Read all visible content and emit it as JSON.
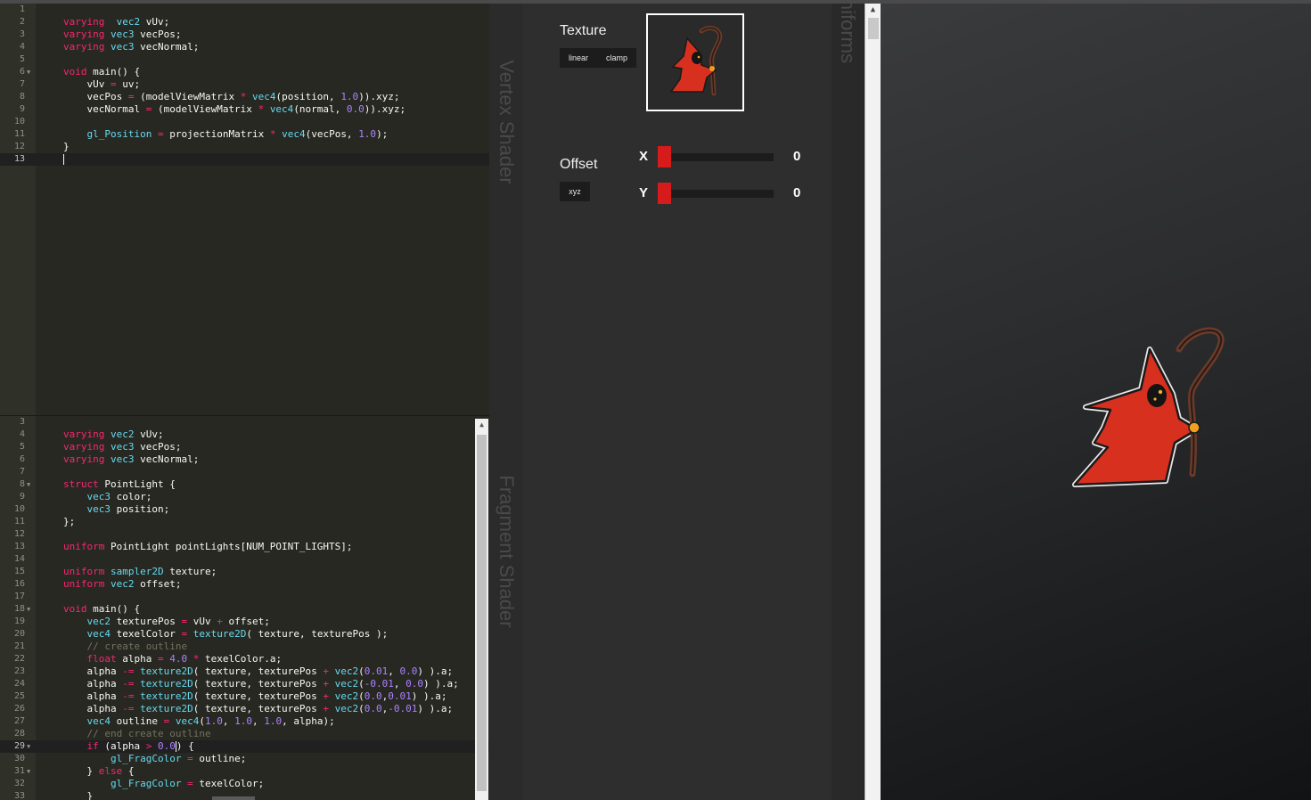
{
  "vertex_shader": {
    "tab_label": "Vertex Shader",
    "lines": [
      {
        "n": "1",
        "fold": false,
        "code": []
      },
      {
        "n": "2",
        "fold": false,
        "code": [
          [
            "kw",
            "varying"
          ],
          [
            "",
            "  "
          ],
          [
            "ty",
            "vec2"
          ],
          [
            "",
            " vUv;"
          ]
        ]
      },
      {
        "n": "3",
        "fold": false,
        "code": [
          [
            "kw",
            "varying"
          ],
          [
            "",
            " "
          ],
          [
            "ty",
            "vec3"
          ],
          [
            "",
            " vecPos;"
          ]
        ]
      },
      {
        "n": "4",
        "fold": false,
        "code": [
          [
            "kw",
            "varying"
          ],
          [
            "",
            " "
          ],
          [
            "ty",
            "vec3"
          ],
          [
            "",
            " vecNormal;"
          ]
        ]
      },
      {
        "n": "5",
        "fold": false,
        "code": []
      },
      {
        "n": "6",
        "fold": true,
        "code": [
          [
            "kw",
            "void"
          ],
          [
            "",
            " main() {"
          ]
        ]
      },
      {
        "n": "7",
        "fold": false,
        "code": [
          [
            "",
            "    vUv "
          ],
          [
            "kw",
            "="
          ],
          [
            "",
            " uv;"
          ]
        ]
      },
      {
        "n": "8",
        "fold": false,
        "code": [
          [
            "",
            "    vecPos "
          ],
          [
            "kw",
            "="
          ],
          [
            "",
            " (modelViewMatrix "
          ],
          [
            "kw",
            "*"
          ],
          [
            "",
            " "
          ],
          [
            "fn",
            "vec4"
          ],
          [
            "",
            "(position, "
          ],
          [
            "num",
            "1.0"
          ],
          [
            "",
            ")).xyz;"
          ]
        ]
      },
      {
        "n": "9",
        "fold": false,
        "code": [
          [
            "",
            "    vecNormal "
          ],
          [
            "kw",
            "="
          ],
          [
            "",
            " (modelViewMatrix "
          ],
          [
            "kw",
            "*"
          ],
          [
            "",
            " "
          ],
          [
            "fn",
            "vec4"
          ],
          [
            "",
            "(normal, "
          ],
          [
            "num",
            "0.0"
          ],
          [
            "",
            ")).xyz;"
          ]
        ]
      },
      {
        "n": "10",
        "fold": false,
        "code": []
      },
      {
        "n": "11",
        "fold": false,
        "code": [
          [
            "",
            "    "
          ],
          [
            "ty",
            "gl_Position"
          ],
          [
            "",
            " "
          ],
          [
            "kw",
            "="
          ],
          [
            "",
            " projectionMatrix "
          ],
          [
            "kw",
            "*"
          ],
          [
            "",
            " "
          ],
          [
            "fn",
            "vec4"
          ],
          [
            "",
            "(vecPos, "
          ],
          [
            "num",
            "1.0"
          ],
          [
            "",
            ");"
          ]
        ]
      },
      {
        "n": "12",
        "fold": false,
        "code": [
          [
            "",
            "}"
          ]
        ]
      },
      {
        "n": "13",
        "fold": false,
        "active": true,
        "cursor": true,
        "code": []
      }
    ]
  },
  "fragment_shader": {
    "tab_label": "Fragment Shader",
    "lines": [
      {
        "n": "3",
        "fold": false,
        "code": []
      },
      {
        "n": "4",
        "fold": false,
        "code": [
          [
            "kw",
            "varying"
          ],
          [
            "",
            " "
          ],
          [
            "ty",
            "vec2"
          ],
          [
            "",
            " vUv;"
          ]
        ]
      },
      {
        "n": "5",
        "fold": false,
        "code": [
          [
            "kw",
            "varying"
          ],
          [
            "",
            " "
          ],
          [
            "ty",
            "vec3"
          ],
          [
            "",
            " vecPos;"
          ]
        ]
      },
      {
        "n": "6",
        "fold": false,
        "code": [
          [
            "kw",
            "varying"
          ],
          [
            "",
            " "
          ],
          [
            "ty",
            "vec3"
          ],
          [
            "",
            " vecNormal;"
          ]
        ]
      },
      {
        "n": "7",
        "fold": false,
        "code": []
      },
      {
        "n": "8",
        "fold": true,
        "code": [
          [
            "kw",
            "struct"
          ],
          [
            "",
            " PointLight {"
          ]
        ]
      },
      {
        "n": "9",
        "fold": false,
        "code": [
          [
            "",
            "    "
          ],
          [
            "ty",
            "vec3"
          ],
          [
            "",
            " color;"
          ]
        ]
      },
      {
        "n": "10",
        "fold": false,
        "code": [
          [
            "",
            "    "
          ],
          [
            "ty",
            "vec3"
          ],
          [
            "",
            " position;"
          ]
        ]
      },
      {
        "n": "11",
        "fold": false,
        "code": [
          [
            "",
            "};"
          ]
        ]
      },
      {
        "n": "12",
        "fold": false,
        "code": []
      },
      {
        "n": "13",
        "fold": false,
        "code": [
          [
            "kw",
            "uniform"
          ],
          [
            "",
            " PointLight pointLights[NUM_POINT_LIGHTS];"
          ]
        ]
      },
      {
        "n": "14",
        "fold": false,
        "code": []
      },
      {
        "n": "15",
        "fold": false,
        "code": [
          [
            "kw",
            "uniform"
          ],
          [
            "",
            " "
          ],
          [
            "ty",
            "sampler2D"
          ],
          [
            "",
            " texture;"
          ]
        ]
      },
      {
        "n": "16",
        "fold": false,
        "code": [
          [
            "kw",
            "uniform"
          ],
          [
            "",
            " "
          ],
          [
            "ty",
            "vec2"
          ],
          [
            "",
            " offset;"
          ]
        ]
      },
      {
        "n": "17",
        "fold": false,
        "code": []
      },
      {
        "n": "18",
        "fold": true,
        "code": [
          [
            "kw",
            "void"
          ],
          [
            "",
            " main() {"
          ]
        ]
      },
      {
        "n": "19",
        "fold": false,
        "code": [
          [
            "",
            "    "
          ],
          [
            "ty",
            "vec2"
          ],
          [
            "",
            " texturePos "
          ],
          [
            "kw",
            "="
          ],
          [
            "",
            " vUv "
          ],
          [
            "kw",
            "+"
          ],
          [
            "",
            " offset;"
          ]
        ]
      },
      {
        "n": "20",
        "fold": false,
        "code": [
          [
            "",
            "    "
          ],
          [
            "ty",
            "vec4"
          ],
          [
            "",
            " texelColor "
          ],
          [
            "kw",
            "="
          ],
          [
            "",
            " "
          ],
          [
            "fn",
            "texture2D"
          ],
          [
            "",
            "( texture, texturePos );"
          ]
        ]
      },
      {
        "n": "21",
        "fold": false,
        "code": [
          [
            "",
            "    "
          ],
          [
            "cm",
            "// create outline"
          ]
        ]
      },
      {
        "n": "22",
        "fold": false,
        "code": [
          [
            "",
            "    "
          ],
          [
            "kw",
            "float"
          ],
          [
            "",
            " alpha "
          ],
          [
            "kw",
            "="
          ],
          [
            "",
            " "
          ],
          [
            "num",
            "4.0"
          ],
          [
            "",
            " "
          ],
          [
            "kw",
            "*"
          ],
          [
            "",
            " texelColor.a;"
          ]
        ]
      },
      {
        "n": "23",
        "fold": false,
        "code": [
          [
            "",
            "    alpha "
          ],
          [
            "kw",
            "-="
          ],
          [
            "",
            " "
          ],
          [
            "fn",
            "texture2D"
          ],
          [
            "",
            "( texture, texturePos "
          ],
          [
            "kw",
            "+"
          ],
          [
            "",
            " "
          ],
          [
            "fn",
            "vec2"
          ],
          [
            "",
            "("
          ],
          [
            "num",
            "0.01"
          ],
          [
            "",
            ", "
          ],
          [
            "num",
            "0.0"
          ],
          [
            "",
            ") ).a;"
          ]
        ]
      },
      {
        "n": "24",
        "fold": false,
        "code": [
          [
            "",
            "    alpha "
          ],
          [
            "kw",
            "-="
          ],
          [
            "",
            " "
          ],
          [
            "fn",
            "texture2D"
          ],
          [
            "",
            "( texture, texturePos "
          ],
          [
            "kw",
            "+"
          ],
          [
            "",
            " "
          ],
          [
            "fn",
            "vec2"
          ],
          [
            "",
            "("
          ],
          [
            "num",
            "-0.01"
          ],
          [
            "",
            ", "
          ],
          [
            "num",
            "0.0"
          ],
          [
            "",
            ") ).a;"
          ]
        ]
      },
      {
        "n": "25",
        "fold": false,
        "code": [
          [
            "",
            "    alpha "
          ],
          [
            "kw",
            "-="
          ],
          [
            "",
            " "
          ],
          [
            "fn",
            "texture2D"
          ],
          [
            "",
            "( texture, texturePos "
          ],
          [
            "kw",
            "+"
          ],
          [
            "",
            " "
          ],
          [
            "fn",
            "vec2"
          ],
          [
            "",
            "("
          ],
          [
            "num",
            "0.0"
          ],
          [
            "",
            ","
          ],
          [
            "num",
            "0.01"
          ],
          [
            "",
            ") ).a;"
          ]
        ]
      },
      {
        "n": "26",
        "fold": false,
        "code": [
          [
            "",
            "    alpha "
          ],
          [
            "kw",
            "-="
          ],
          [
            "",
            " "
          ],
          [
            "fn",
            "texture2D"
          ],
          [
            "",
            "( texture, texturePos "
          ],
          [
            "kw",
            "+"
          ],
          [
            "",
            " "
          ],
          [
            "fn",
            "vec2"
          ],
          [
            "",
            "("
          ],
          [
            "num",
            "0.0"
          ],
          [
            "",
            ","
          ],
          [
            "num",
            "-0.01"
          ],
          [
            "",
            ") ).a;"
          ]
        ]
      },
      {
        "n": "27",
        "fold": false,
        "code": [
          [
            "",
            "    "
          ],
          [
            "ty",
            "vec4"
          ],
          [
            "",
            " outline "
          ],
          [
            "kw",
            "="
          ],
          [
            "",
            " "
          ],
          [
            "fn",
            "vec4"
          ],
          [
            "",
            "("
          ],
          [
            "num",
            "1.0"
          ],
          [
            "",
            ", "
          ],
          [
            "num",
            "1.0"
          ],
          [
            "",
            ", "
          ],
          [
            "num",
            "1.0"
          ],
          [
            "",
            ", alpha);"
          ]
        ]
      },
      {
        "n": "28",
        "fold": false,
        "code": [
          [
            "",
            "    "
          ],
          [
            "cm",
            "// end create outline"
          ]
        ]
      },
      {
        "n": "29",
        "fold": true,
        "active": true,
        "code": [
          [
            "",
            "    "
          ],
          [
            "kw",
            "if"
          ],
          [
            "",
            " (alpha "
          ],
          [
            "kw",
            ">"
          ],
          [
            "",
            " "
          ],
          [
            "num",
            "0.0"
          ],
          [
            "cursor",
            ""
          ],
          [
            "",
            ") {"
          ]
        ]
      },
      {
        "n": "30",
        "fold": false,
        "code": [
          [
            "",
            "        "
          ],
          [
            "ty",
            "gl_FragColor"
          ],
          [
            "",
            " "
          ],
          [
            "kw",
            "="
          ],
          [
            "",
            " outline;"
          ]
        ]
      },
      {
        "n": "31",
        "fold": true,
        "code": [
          [
            "",
            "    } "
          ],
          [
            "kw",
            "else"
          ],
          [
            "",
            " {"
          ]
        ]
      },
      {
        "n": "32",
        "fold": false,
        "code": [
          [
            "",
            "        "
          ],
          [
            "ty",
            "gl_FragColor"
          ],
          [
            "",
            " "
          ],
          [
            "kw",
            "="
          ],
          [
            "",
            " texelColor;"
          ]
        ]
      },
      {
        "n": "33",
        "fold": false,
        "code": [
          [
            "",
            "    }"
          ]
        ]
      }
    ]
  },
  "uniforms": {
    "tab_label": "Uniforms",
    "texture": {
      "title": "Texture",
      "filter_label": "linear",
      "wrap_label": "clamp",
      "preview_icon": "red-mage-sprite"
    },
    "offset": {
      "title": "Offset",
      "type_label": "xyz",
      "x_label": "X",
      "x_value": "0",
      "x_fraction": 0.0,
      "y_label": "Y",
      "y_value": "0",
      "y_fraction": 0.0
    }
  },
  "viewport": {
    "sprite_icon": "red-mage-sprite-with-outline"
  },
  "colors": {
    "accent_red": "#d71a1a",
    "editor_bg": "#272822",
    "panel_bg": "#2e2e2e"
  }
}
